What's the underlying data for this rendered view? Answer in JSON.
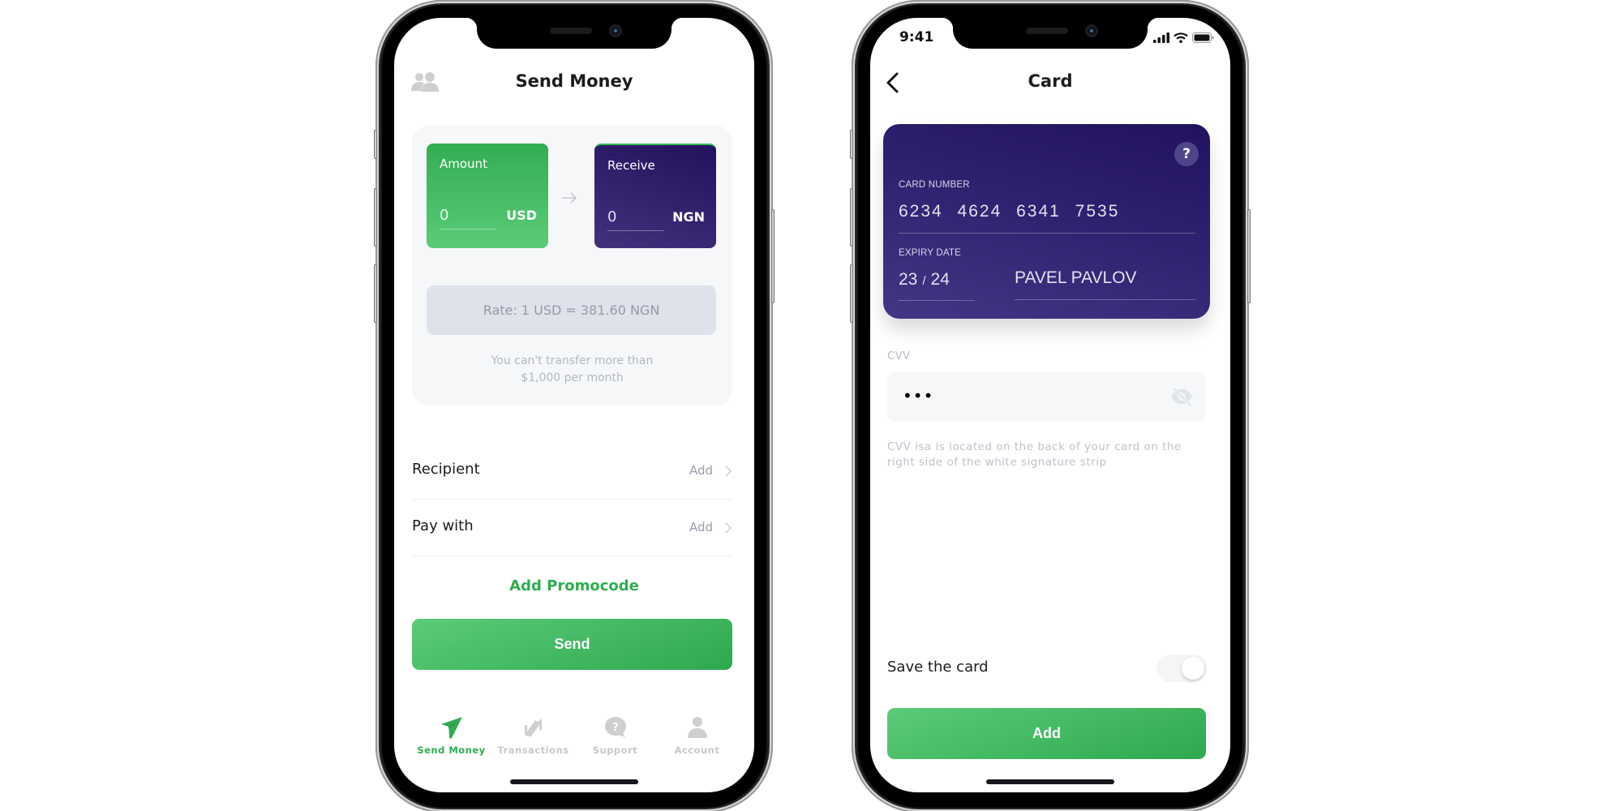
{
  "send_money_screen": {
    "title": "Send Money",
    "header_icon": "people-icon",
    "amount": {
      "label": "Amount",
      "value": "0",
      "currency": "USD"
    },
    "arrow_icon": "arrow-right-icon",
    "receive": {
      "label": "Receive",
      "value": "0",
      "currency": "NGN"
    },
    "rate": "Rate: 1 USD = 381.60 NGN",
    "limit_note_line1": "You can't transfer more than",
    "limit_note_line2": "$1,000 per month",
    "rows": [
      {
        "label": "Recipient",
        "action": "Add"
      },
      {
        "label": "Pay with",
        "action": "Add"
      }
    ],
    "promo_link": "Add Promocode",
    "send_button": "Send",
    "tabs": [
      {
        "label": "Send Money",
        "icon": "paper-plane-icon",
        "active": true
      },
      {
        "label": "Transactions",
        "icon": "transactions-icon",
        "active": false
      },
      {
        "label": "Support",
        "icon": "support-chat-icon",
        "active": false
      },
      {
        "label": "Account",
        "icon": "user-icon",
        "active": false
      }
    ]
  },
  "card_screen": {
    "status_time": "9:41",
    "title": "Card",
    "back_icon": "chevron-left-icon",
    "card": {
      "help": "?",
      "number_label": "CARD NUMBER",
      "number": "6234 4624 6341 7535",
      "expiry_label": "EXPIRY DATE",
      "expiry_month": "23",
      "expiry_sep": "/",
      "expiry_year": "24",
      "holder": "PAVEL PAVLOV"
    },
    "cvv_label": "CVV",
    "cvv_value": "•••",
    "cvv_hint": "CVV isa is located on the back of your card on the right side of the white signature strip",
    "save_label": "Save the card",
    "save_toggle_on": false,
    "add_button": "Add"
  },
  "colors": {
    "accent_green": "#2fad50",
    "card_purple": "#22125e",
    "muted_text": "#b4b7c2"
  }
}
